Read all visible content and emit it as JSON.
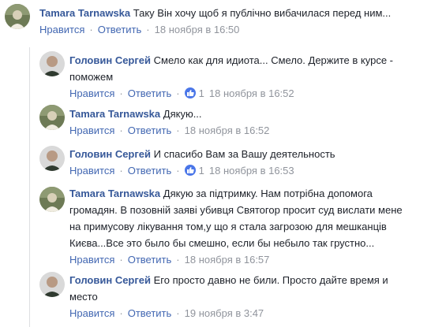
{
  "comments": [
    {
      "author": "Tamara Tarnawska",
      "lines": [
        "Таку Він хочу щоб я публічно вибачилася перед ним..."
      ],
      "like": "Нравится",
      "reply": "Ответить",
      "time": "18 ноября в 16:50",
      "likes": null
    },
    {
      "author": "Головин Сергей",
      "lines": [
        "Смело как для идиота... Смело. Держите в курсе -",
        "поможем"
      ],
      "like": "Нравится",
      "reply": "Ответить",
      "time": "18 ноября в 16:52",
      "likes": "1"
    },
    {
      "author": "Tamara Tarnawska",
      "lines": [
        "Дякую..."
      ],
      "like": "Нравится",
      "reply": "Ответить",
      "time": "18 ноября в 16:52",
      "likes": null
    },
    {
      "author": "Головин Сергей",
      "lines": [
        "И спасибо Вам за Вашу деятельность"
      ],
      "like": "Нравится",
      "reply": "Ответить",
      "time": "18 ноября в 16:53",
      "likes": "1"
    },
    {
      "author": "Tamara Tarnawska",
      "lines": [
        "Дякую за підтримку. Нам потрібна допомога",
        "громадян. В позовній заяві убивця Святогор просит суд вислати мене",
        "на примусову лікування том,у що я стала загрозою для мешканців",
        "Києва...Все это было бы смешно, если бы небыло так грустно..."
      ],
      "like": "Нравится",
      "reply": "Ответить",
      "time": "18 ноября в 16:57",
      "likes": null
    },
    {
      "author": "Головин Сергей",
      "lines": [
        "Его просто давно не били. Просто дайте время и",
        "место"
      ],
      "like": "Нравится",
      "reply": "Ответить",
      "time": "19 ноября в 3:47",
      "likes": null
    }
  ],
  "colors": {
    "author": "#365899",
    "action": "#4267b2",
    "meta": "#90949c",
    "like_badge": "#4a76e8"
  },
  "icons": {
    "like": "thumbs-up-icon"
  }
}
